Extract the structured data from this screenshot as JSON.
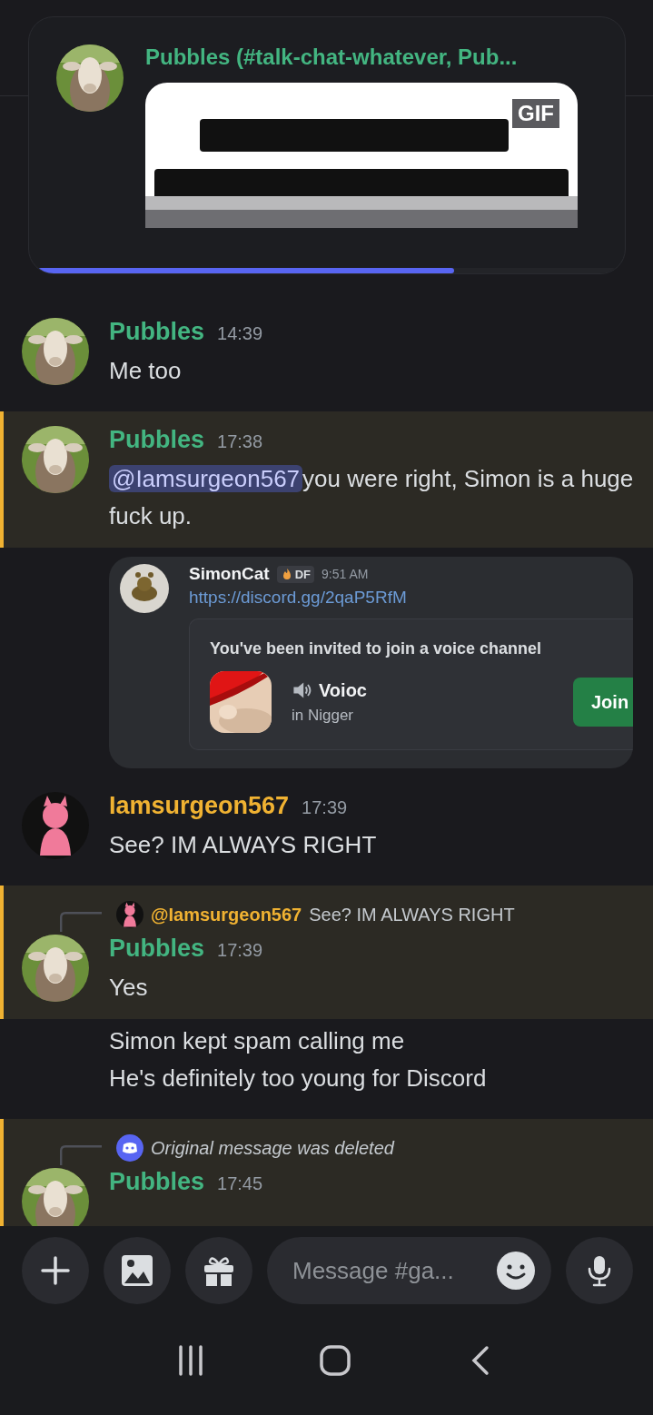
{
  "notification": {
    "author": "Pubbles (#talk-chat-whatever, Pub...",
    "gif_badge": "GIF",
    "level": 0.72
  },
  "messages": [
    {
      "kind": "message",
      "avatar": {
        "kind": "goat"
      },
      "author": "Pubbles",
      "color": "#43b581",
      "time": "14:39",
      "highlighted": false,
      "lines": [
        "Me too"
      ]
    },
    {
      "kind": "message",
      "avatar": {
        "kind": "goat"
      },
      "author": "Pubbles",
      "color": "#43b581",
      "time": "17:38",
      "highlighted": true,
      "mention": "@Iamsurgeon567",
      "lines": [
        "you were right, Simon is a huge fuck up."
      ]
    },
    {
      "kind": "embed",
      "author": "SimonCat",
      "badge": "DF",
      "time": "9:51 AM",
      "link": "https://discord.gg/2qaP5RfM",
      "invite": {
        "title": "You've been invited to join a voice channel",
        "channel": "Voioc",
        "server": "in Nigger",
        "button": "Join"
      }
    },
    {
      "kind": "message",
      "avatar": {
        "kind": "character"
      },
      "author": "Iamsurgeon567",
      "color": "#f0b232",
      "time": "17:39",
      "highlighted": false,
      "lines": [
        "See? IM ALWAYS RIGHT"
      ]
    },
    {
      "kind": "message",
      "avatar": {
        "kind": "goat"
      },
      "author": "Pubbles",
      "color": "#43b581",
      "time": "17:39",
      "highlighted": true,
      "reply": {
        "kind": "user",
        "author": "@Iamsurgeon567",
        "color": "#f0b232",
        "text": "See? IM ALWAYS RIGHT"
      },
      "lines": [
        "Yes"
      ]
    },
    {
      "kind": "continuation",
      "lines": [
        "Simon kept spam calling me",
        "He's definitely too young for Discord"
      ]
    },
    {
      "kind": "message",
      "avatar": {
        "kind": "goat"
      },
      "author": "Pubbles",
      "color": "#43b581",
      "time": "17:45",
      "highlighted": true,
      "reply": {
        "kind": "deleted",
        "text": "Original message was deleted"
      }
    }
  ],
  "composer": {
    "placeholder": "Message #ga..."
  }
}
